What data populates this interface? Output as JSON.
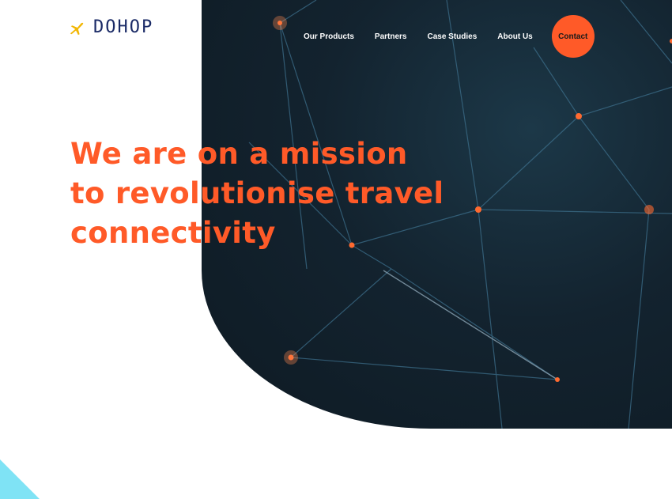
{
  "brand": {
    "name": "DOHOP",
    "logo_icon": "plane-icon",
    "logo_color": "#1a2a66",
    "icon_color": "#f2b705"
  },
  "nav": {
    "items": [
      {
        "label": "Our Products"
      },
      {
        "label": "Partners"
      },
      {
        "label": "Case Studies"
      },
      {
        "label": "About Us"
      }
    ],
    "contact_label": "Contact"
  },
  "hero": {
    "lines": [
      "We are on a mission",
      "to revolutionise travel",
      "connectivity"
    ]
  },
  "colors": {
    "accent": "#ff5a28",
    "dark_bg": "#13232f",
    "corner": "#7fe3f5"
  }
}
